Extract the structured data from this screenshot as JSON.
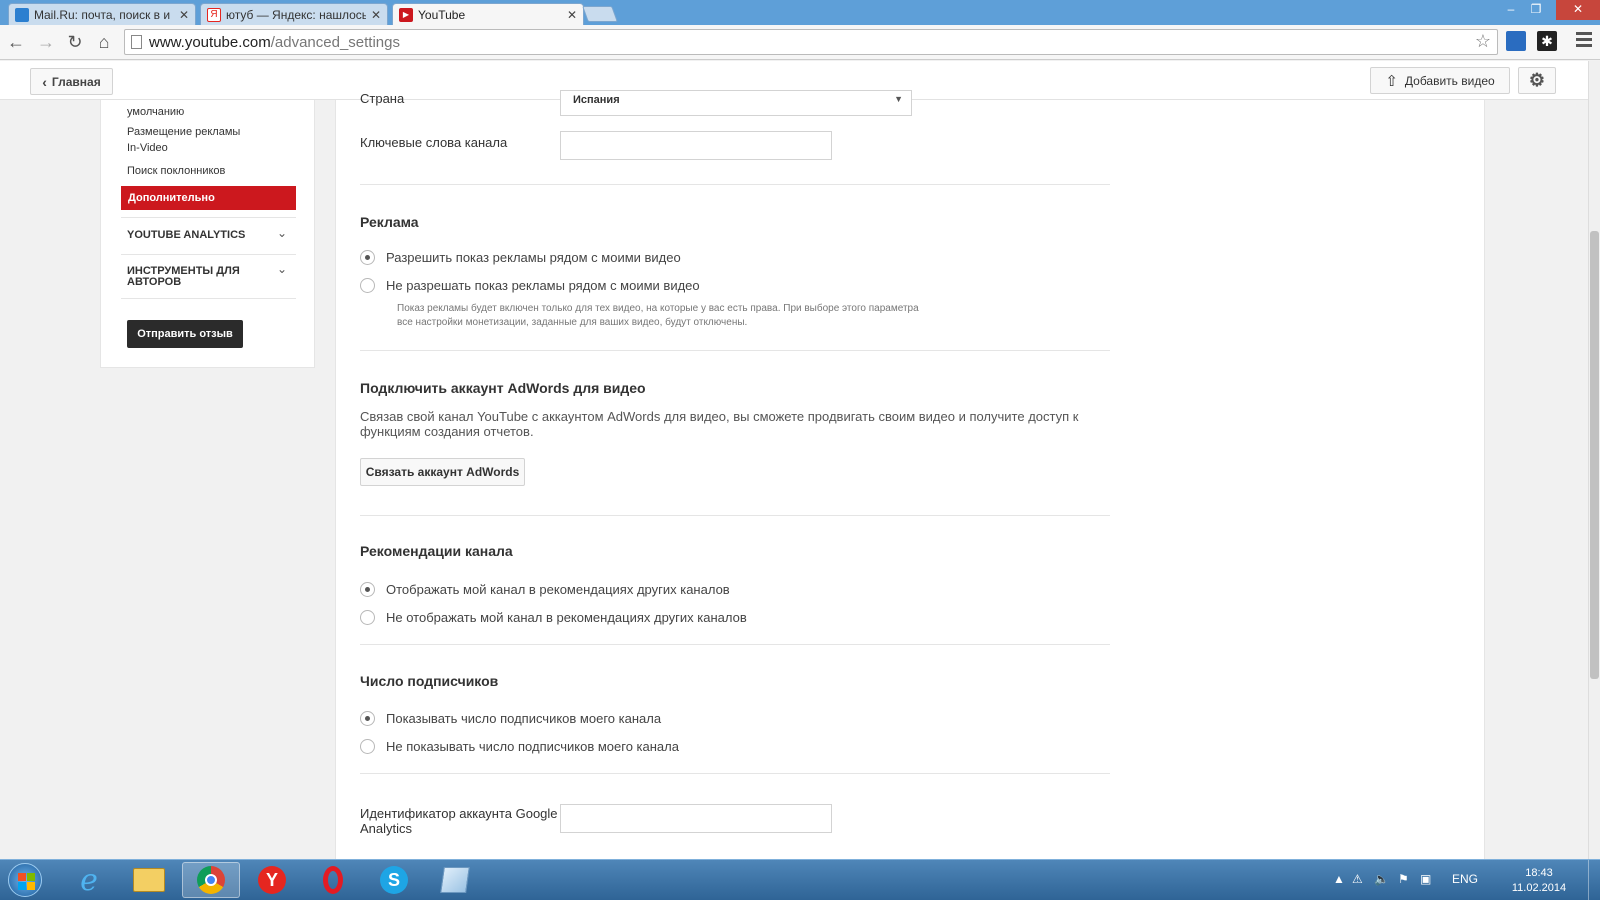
{
  "browser": {
    "tabs": [
      {
        "label": "Mail.Ru: почта, поиск в и",
        "icon": "mailru-icon",
        "color": "#2b7fd0"
      },
      {
        "label": "ютуб — Яндекс: нашлось",
        "icon": "yandex-icon",
        "color": "#e52620"
      },
      {
        "label": "YouTube",
        "icon": "youtube-icon",
        "color": "#cc181e"
      }
    ],
    "url_host": "www.youtube.com",
    "url_path": "/advanced_settings"
  },
  "header": {
    "home_label": "Главная",
    "upload_label": "Добавить видео"
  },
  "sidebar": {
    "partial_item": "умолчанию",
    "items": [
      "Размещение рекламы In-Video",
      "Поиск поклонников"
    ],
    "active_item": "Дополнительно",
    "sections": [
      "YOUTUBE ANALYTICS",
      "ИНСТРУМЕНТЫ ДЛЯ АВТОРОВ"
    ],
    "feedback_label": "Отправить отзыв"
  },
  "main": {
    "country_label": "Страна",
    "country_value": "Испания",
    "keywords_label": "Ключевые слова канала",
    "keywords_value": "",
    "ads": {
      "title": "Реклама",
      "options": [
        "Разрешить показ рекламы рядом с моими видео",
        "Не разрешать показ рекламы рядом с моими видео"
      ],
      "selected": 0,
      "hint": "Показ рекламы будет включен только для тех видео, на которые у вас есть права. При выборе этого параметра все настройки монетизации, заданные для ваших видео, будут отключены."
    },
    "adwords": {
      "title": "Подключить аккаунт AdWords для видео",
      "description": "Связав свой канал YouTube с аккаунтом AdWords для видео, вы сможете продвигать своим видео и получите доступ к функциям создания отчетов.",
      "button_label": "Связать аккаунт AdWords"
    },
    "recommendations": {
      "title": "Рекомендации канала",
      "options": [
        "Отображать мой канал в рекомендациях других каналов",
        "Не отображать мой канал в рекомендациях других каналов"
      ],
      "selected": 0
    },
    "subscribers": {
      "title": "Число подписчиков",
      "options": [
        "Показывать число подписчиков моего канала",
        "Не показывать число подписчиков моего канала"
      ],
      "selected": 0
    },
    "analytics_label": "Идентификатор аккаунта Google Analytics",
    "analytics_value": ""
  },
  "taskbar": {
    "apps": [
      "internet-explorer",
      "file-explorer",
      "chrome",
      "yandex-browser",
      "opera",
      "skype",
      "notes"
    ],
    "language": "ENG",
    "time": "18:43",
    "date": "11.02.2014"
  },
  "colors": {
    "accent_red": "#cc181e",
    "titlebar_blue": "#5e9fd8",
    "taskbar_blue": "#2f6496"
  }
}
